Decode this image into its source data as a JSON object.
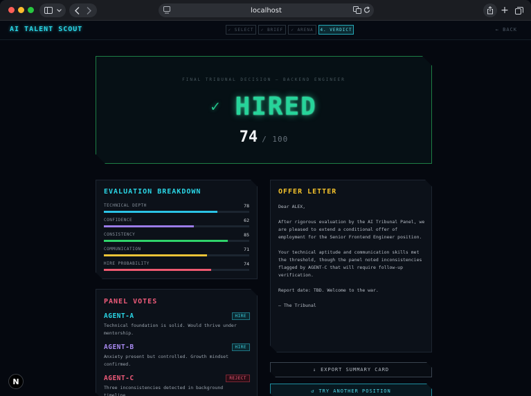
{
  "browser": {
    "url": "localhost",
    "icons": {
      "sidebar": "sidebar-icon",
      "chevron": "chevron-down-icon",
      "back": "chevron-left-icon",
      "forward": "chevron-right-icon",
      "site": "site-settings-icon",
      "translate": "translate-icon",
      "reload": "reload-icon",
      "share": "share-icon",
      "new_tab": "plus-icon",
      "tab_overview": "tabs-icon"
    }
  },
  "header": {
    "logo": "AI TALENT SCOUT",
    "steps": [
      "✓ SELECT",
      "✓ BRIEF",
      "✓ ARENA",
      "4. VERDICT"
    ],
    "back": "← BACK"
  },
  "verdict": {
    "subtitle": "FINAL TRIBUNAL DECISION — BACKEND ENGINEER",
    "check": "✓",
    "decision": "HIRED",
    "score": "74",
    "score_of": "/ 100",
    "color": "#26d49a"
  },
  "evaluation": {
    "title": "EVALUATION BREAKDOWN",
    "metrics": [
      {
        "label": "TECHNICAL DEPTH",
        "value": "78",
        "fill": 0.78,
        "color": "#2bc3e6"
      },
      {
        "label": "CONFIDENCE",
        "value": "62",
        "fill": 0.62,
        "color": "#9b7ce8"
      },
      {
        "label": "CONSISTENCY",
        "value": "85",
        "fill": 0.85,
        "color": "#2fd36a"
      },
      {
        "label": "COMMUNICATION",
        "value": "71",
        "fill": 0.71,
        "color": "#ecc437"
      },
      {
        "label": "HIRE PROBABILITY",
        "value": "74",
        "fill": 0.74,
        "color": "#ee5a70"
      }
    ]
  },
  "votes": {
    "title": "PANEL VOTES",
    "agents": [
      {
        "name": "AGENT-A",
        "color": "#2ad6e6",
        "vote": "HIRE",
        "text": "Technical foundation is solid. Would thrive under mentorship."
      },
      {
        "name": "AGENT-B",
        "color": "#a889f0",
        "vote": "HIRE",
        "text": "Anxiety present but controlled. Growth mindset confirmed."
      },
      {
        "name": "AGENT-C",
        "color": "#ef5b7a",
        "vote": "REJECT",
        "text": "Three inconsistencies detected in background timeline."
      }
    ]
  },
  "offer": {
    "title": "OFFER LETTER",
    "greeting": "Dear ALEX,",
    "p1": "After rigorous evaluation by the AI Tribunal Panel, we are pleased to extend a conditional offer of employment for the Senior Frontend Engineer position.",
    "p2": "Your technical aptitude and communication skills met the threshold, though the panel noted inconsistencies flagged by AGENT-C that will require follow-up verification.",
    "p3": "Report date: TBD. Welcome to the war.",
    "sign": "— The Tribunal"
  },
  "actions": {
    "export": "EXPORT SUMMARY CARD",
    "export_icon": "↓",
    "try": "TRY ANOTHER POSITION",
    "try_icon": "↺"
  },
  "dev_badge": "N"
}
